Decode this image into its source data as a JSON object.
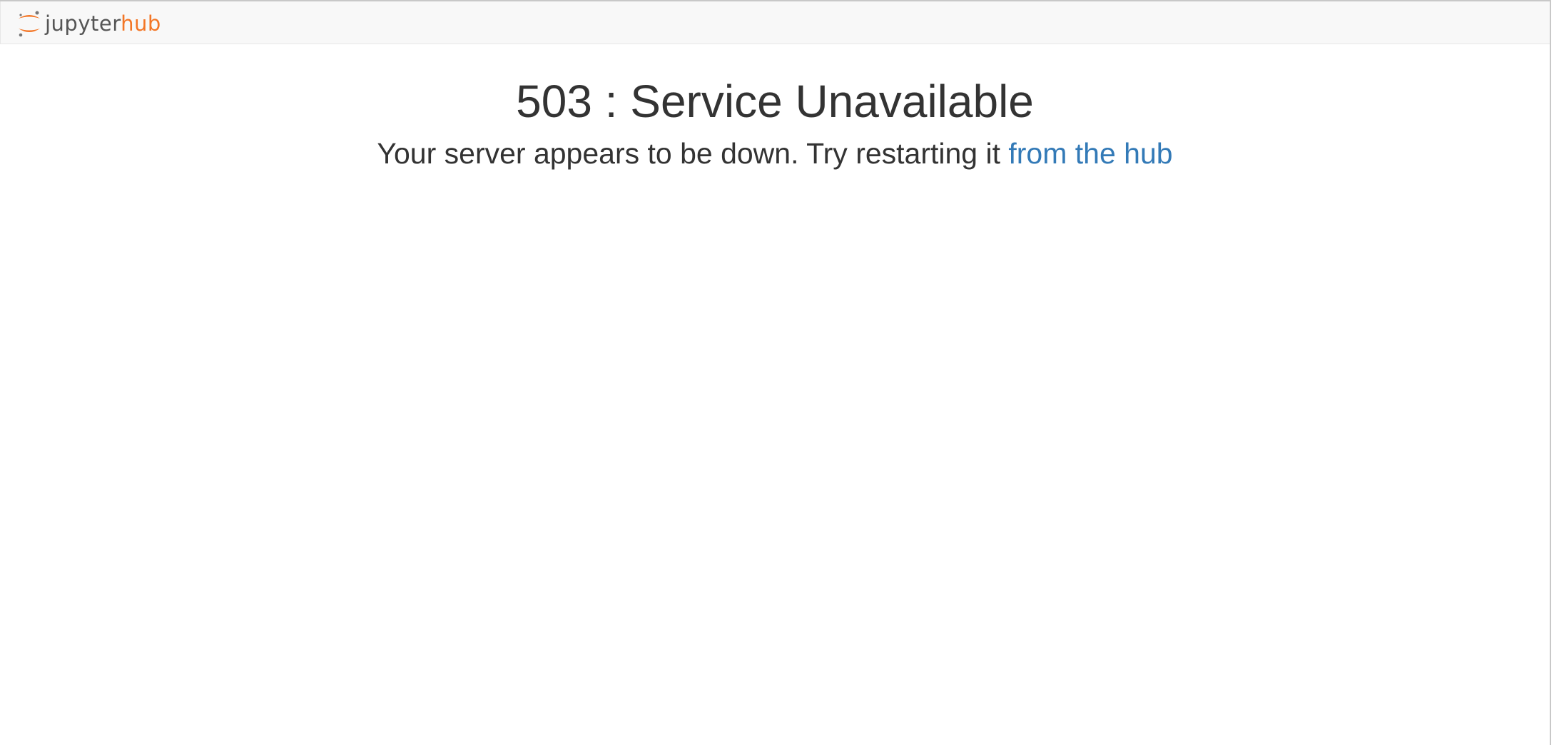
{
  "header": {
    "logo": {
      "icon": "jupyter-logo-icon",
      "text_part1": "jupyter",
      "text_part2": "hub",
      "brand_color": "#f37626"
    }
  },
  "error": {
    "title": "503 : Service Unavailable",
    "message_prefix": "Your server appears to be down. Try restarting it ",
    "link_text": "from the hub",
    "link_color": "#337ab7"
  }
}
